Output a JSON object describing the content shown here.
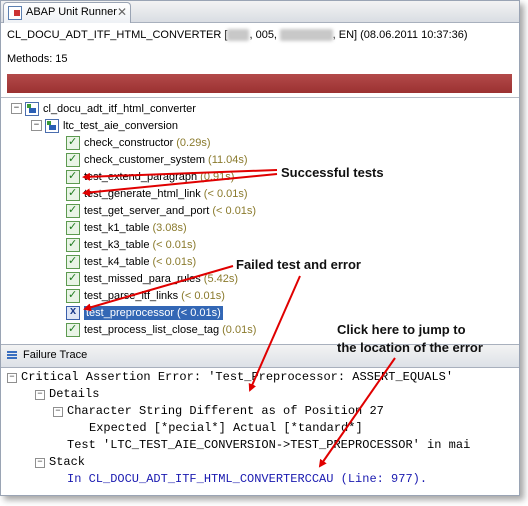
{
  "tab": {
    "title": "ABAP Unit Runner",
    "close": "✕"
  },
  "header": {
    "class_name": "CL_DOCU_ADT_ITF_HTML_CONVERTER [",
    "blur1": "SAP",
    "mid": ", 005, ",
    "blur2": "USERXXX",
    "tail": ", EN] (08.06.2011 10:37:36)"
  },
  "methods": "Methods:  15",
  "tree": {
    "root": "cl_docu_adt_itf_html_converter",
    "test_class": "ltc_test_aie_conversion",
    "tests": [
      {
        "name": "check_constructor",
        "time": "(0.29s)"
      },
      {
        "name": "check_customer_system",
        "time": "(11.04s)"
      },
      {
        "name": "test_extend_paragraph",
        "time": "(0.91s)"
      },
      {
        "name": "test_generate_html_link",
        "time": "(< 0.01s)"
      },
      {
        "name": "test_get_server_and_port",
        "time": "(< 0.01s)"
      },
      {
        "name": "test_k1_table",
        "time": "(3.08s)"
      },
      {
        "name": "test_k3_table",
        "time": "(< 0.01s)"
      },
      {
        "name": "test_k4_table",
        "time": "(< 0.01s)"
      },
      {
        "name": "test_missed_para_rules",
        "time": "(5.42s)"
      },
      {
        "name": "test_parse_itf_links",
        "time": "(< 0.01s)"
      },
      {
        "name": "test_preprocessor",
        "time": "(< 0.01s)"
      },
      {
        "name": "test_process_list_close_tag",
        "time": "(0.01s)"
      }
    ]
  },
  "failure_trace": {
    "title": "Failure Trace",
    "lines": {
      "critical": "Critical Assertion Error: 'Test_Preprocessor: ASSERT_EQUALS'",
      "details": "Details",
      "char_diff": "Character String Different as of Position 27",
      "expected": "Expected [*pecial*] Actual [*tandard*]",
      "test": "Test 'LTC_TEST_AIE_CONVERSION->TEST_PREPROCESSOR' in mai",
      "stack": "Stack",
      "location": "In CL_DOCU_ADT_ITF_HTML_CONVERTERCCAU (Line: 977)."
    }
  },
  "annotations": {
    "successful": "Successful tests",
    "failed": "Failed test and error",
    "click1": "Click here to jump to",
    "click2": "the location of the error"
  },
  "colors": {
    "progress": "#a63a3a",
    "selection": "#3367b5",
    "arrow": "#e00000"
  }
}
